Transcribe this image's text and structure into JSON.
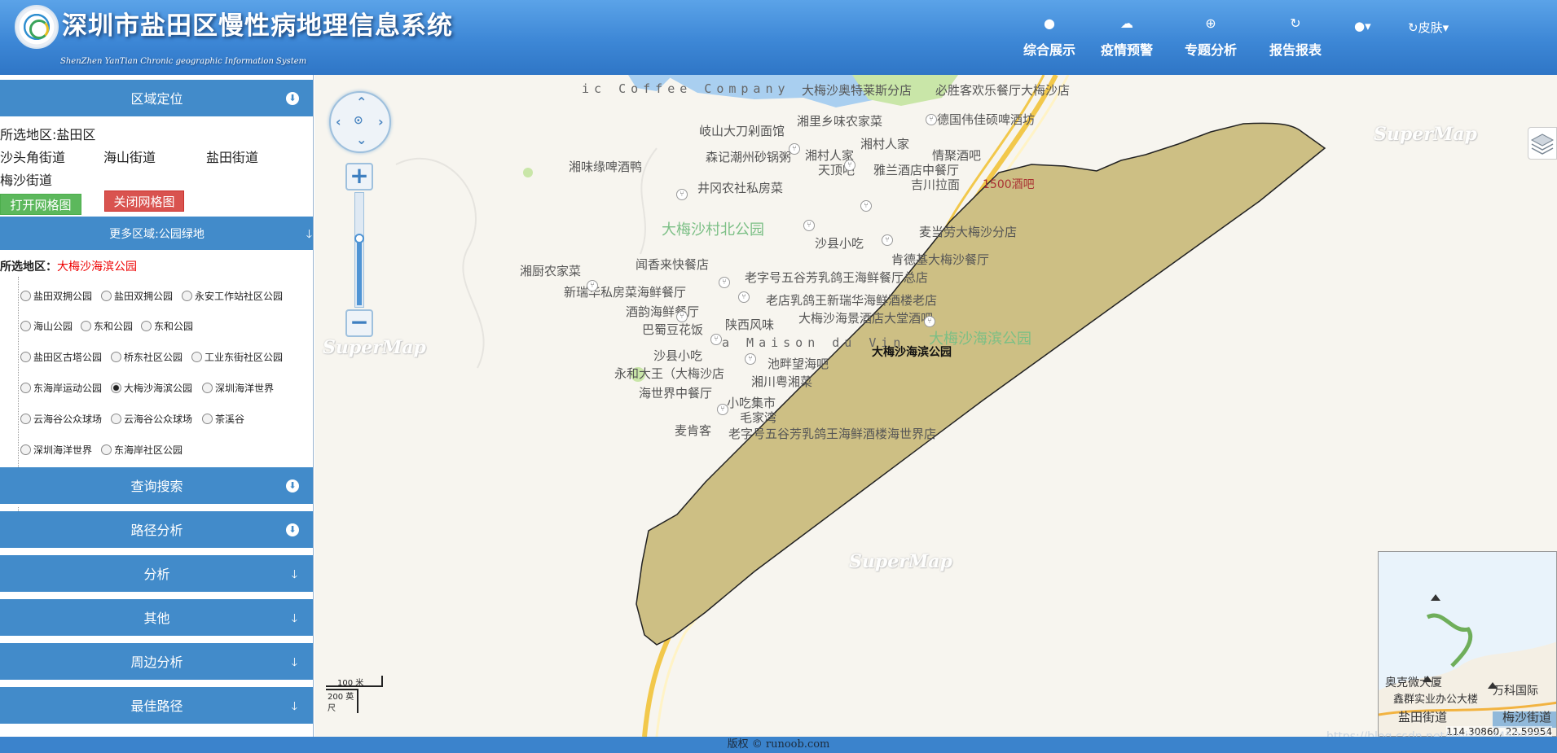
{
  "header": {
    "title": "深圳市盐田区慢性病地理信息系统",
    "subtitle": "ShenZhen YanTian Chronic geographic Information System",
    "nav": [
      {
        "label": "综合展示",
        "icon": "apple-icon"
      },
      {
        "label": "疫情预警",
        "icon": "cloud-icon"
      },
      {
        "label": "专题分析",
        "icon": "download-circle-icon"
      },
      {
        "label": "报告报表",
        "icon": "refresh-icon"
      }
    ],
    "apple_menu_label": "▾",
    "skin_label": "皮肤"
  },
  "panel": {
    "region_title": "区域定位",
    "selected_area_label": "所选地区:盐田区",
    "streets": [
      "沙头角街道",
      "海山街道",
      "盐田街道",
      "梅沙街道"
    ],
    "open_grid_label": "打开网格图",
    "close_grid_label": "关闭网格图",
    "more_regions_title": "更多区域:公园绿地",
    "selected_park_prefix": "所选地区：",
    "selected_park": "大梅沙海滨公园",
    "parks": [
      {
        "name": "盐田双拥公园",
        "checked": false
      },
      {
        "name": "盐田双拥公园",
        "checked": false
      },
      {
        "name": "永安工作站社区公园",
        "checked": false
      },
      {
        "name": "海山公园",
        "checked": false
      },
      {
        "name": "东和公园",
        "checked": false
      },
      {
        "name": "东和公园",
        "checked": false
      },
      {
        "name": "盐田区古塔公园",
        "checked": false
      },
      {
        "name": "桥东社区公园",
        "checked": false
      },
      {
        "name": "工业东街社区公园",
        "checked": false
      },
      {
        "name": "东海岸运动公园",
        "checked": false
      },
      {
        "name": "大梅沙海滨公园",
        "checked": true
      },
      {
        "name": "深圳海洋世界",
        "checked": false
      },
      {
        "name": "云海谷公众球场",
        "checked": false
      },
      {
        "name": "云海谷公众球场",
        "checked": false
      },
      {
        "name": "茶溪谷",
        "checked": false
      },
      {
        "name": "深圳海洋世界",
        "checked": false
      },
      {
        "name": "东海岸社区公园",
        "checked": false
      }
    ],
    "sections": [
      {
        "label": "查询搜索"
      },
      {
        "label": "路径分析"
      },
      {
        "label": "分析"
      },
      {
        "label": "其他"
      },
      {
        "label": "周边分析"
      },
      {
        "label": "最佳路径"
      }
    ]
  },
  "map": {
    "labels": [
      "ic Coffee Company",
      "大梅沙奥特莱斯分店",
      "必胜客欢乐餐厅大梅沙店",
      "德国伟佳硕啤酒坊",
      "湘里乡味农家菜",
      "岐山大刀剁面馆",
      "湘村人家",
      "森记潮州砂锅粥",
      "湘村人家",
      "情聚酒吧",
      "天顶吧",
      "雅兰酒店中餐厅",
      "湘味缘啤酒鸭",
      "吉川拉面",
      "1500酒吧",
      "井冈农社私房菜",
      "大梅沙村北公园",
      "麦当劳大梅沙分店",
      "沙县小吃",
      "肯德基大梅沙餐厅",
      "闻香来快餐店",
      "湘厨农家菜",
      "老字号五谷芳乳鸽王海鲜餐厅总店",
      "新瑞华私房菜海鲜餐厅",
      "老店乳鸽王新瑞华海鲜酒楼老店",
      "酒韵海鲜餐厅",
      "大梅沙海景酒店大堂酒吧",
      "巴蜀豆花饭",
      "陕西风味",
      "大梅沙海滨公园",
      "a Maison du Vin",
      "大梅沙海滨公园",
      "沙县小吃",
      "池畔望海吧",
      "永和大王（大梅沙店",
      "湘川粤湘菜",
      "海世界中餐厅",
      "小吃集市",
      "毛家湾",
      "麦肯客",
      "老字号五谷芳乳鸽王海鲜酒楼海世界店"
    ],
    "watermark": "SuperMap",
    "scale_top": "100 米",
    "scale_bottom": "200 英尺",
    "coords": "114.30860, 22.59954",
    "overview_labels": [
      "奥克微大厦",
      "鑫群实业办公大楼",
      "万科国际",
      "盐田街道",
      "梅沙街道"
    ],
    "polygon_fill": "#cdbf84",
    "road_color": "#f2c84b",
    "url_watermark": "https://blog.csdn.net/weixin_44500027"
  },
  "footer": {
    "copyright": "版权 © runoob.com"
  }
}
